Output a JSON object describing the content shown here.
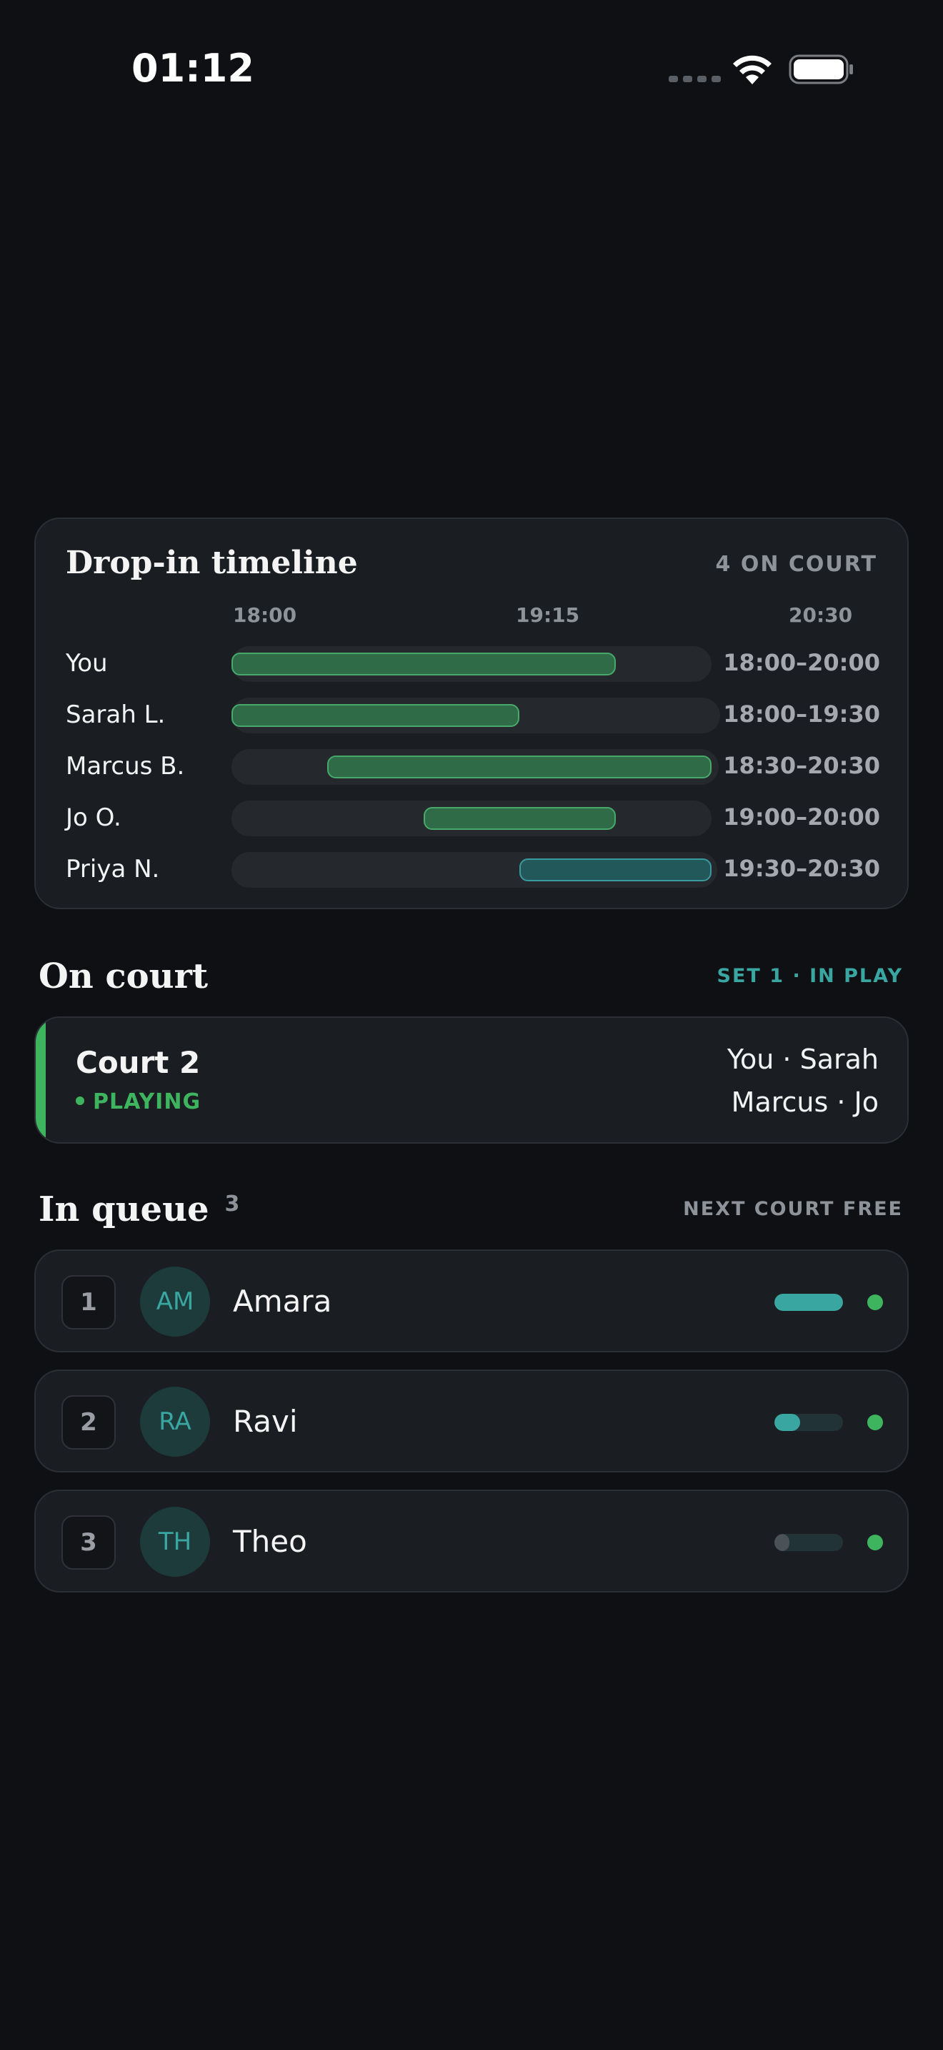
{
  "status_bar": {
    "time": "01:12"
  },
  "timeline": {
    "title": "Drop-in timeline",
    "count_label": "4 ON COURT",
    "ticks": [
      "18:00",
      "19:15",
      "20:30"
    ],
    "rows": [
      {
        "name": "You",
        "start": "18:00",
        "end": "20:00",
        "range": "18:00–20:00",
        "color": "green"
      },
      {
        "name": "Sarah L.",
        "start": "18:00",
        "end": "19:30",
        "range": "18:00–19:30",
        "color": "green"
      },
      {
        "name": "Marcus B.",
        "start": "18:30",
        "end": "20:30",
        "range": "18:30–20:30",
        "color": "green"
      },
      {
        "name": "Jo O.",
        "start": "19:00",
        "end": "20:00",
        "range": "19:00–20:00",
        "color": "green"
      },
      {
        "name": "Priya N.",
        "start": "19:30",
        "end": "20:30",
        "range": "19:30–20:30",
        "color": "teal"
      }
    ]
  },
  "on_court": {
    "title": "On court",
    "status_right": "SET 1 · IN PLAY",
    "court": {
      "name": "Court 2",
      "status": "PLAYING",
      "team_1": "You · Sarah",
      "team_2": "Marcus · Jo"
    }
  },
  "queue": {
    "title": "In queue",
    "count": "3",
    "status_right": "NEXT COURT FREE",
    "items": [
      {
        "position": "1",
        "initials": "AM",
        "name": "Amara",
        "meter": 1.0,
        "meter_color": "#3aa6a2"
      },
      {
        "position": "2",
        "initials": "RA",
        "name": "Ravi",
        "meter": 0.38,
        "meter_color": "#3aa6a2"
      },
      {
        "position": "3",
        "initials": "TH",
        "name": "Theo",
        "meter": 0.2,
        "meter_color": "#4a5258"
      }
    ]
  },
  "colors": {
    "background": "#0e1013",
    "card": "#1a1d21",
    "accent_green": "#3fb45f",
    "accent_teal": "#3aa6a2",
    "muted_text": "#8e939a"
  }
}
